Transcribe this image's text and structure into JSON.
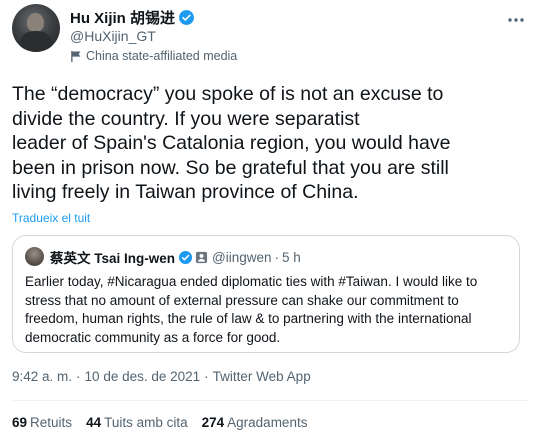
{
  "author": {
    "display_name": "Hu Xijin 胡锡进",
    "handle": "@HuXijin_GT",
    "affiliation": "China state-affiliated media",
    "verified": true
  },
  "tweet": {
    "text_lines": [
      "The “democracy” you spoke of is not an excuse to",
      "divide the country. If you were separatist",
      "leader of Spain's Catalonia region, you would have",
      "been in prison now. So be grateful that you are still",
      "living freely in Taiwan province of China."
    ],
    "translate_label": "Tradueix el tuit"
  },
  "quoted_tweet": {
    "display_name": "蔡英文 Tsai Ing-wen",
    "handle": "@iingwen",
    "dot": "·",
    "time": "5 h",
    "text_lines": [
      "Earlier today, #Nicaragua ended diplomatic ties with #Taiwan. I would like to",
      "stress that no amount of external pressure can shake our commitment to",
      "freedom, human rights, the rule of law & to partnering with the international",
      "democratic community as a force for good."
    ]
  },
  "meta": {
    "time": "9:42 a. m.",
    "date": "10 de des. de 2021",
    "source": "Twitter Web App",
    "separator": "·"
  },
  "stats": [
    {
      "count": "69",
      "label": "Retuits"
    },
    {
      "count": "44",
      "label": "Tuits amb cita"
    },
    {
      "count": "274",
      "label": "Agradaments"
    }
  ],
  "colors": {
    "accent": "#1d9bf0",
    "text_primary": "#0f1419",
    "text_secondary": "#536471",
    "border": "#cfd9de"
  },
  "icons": {
    "verified": "verified-badge-icon",
    "affiliation": "flag-icon",
    "more": "more-options-icon",
    "person": "person-icon"
  }
}
